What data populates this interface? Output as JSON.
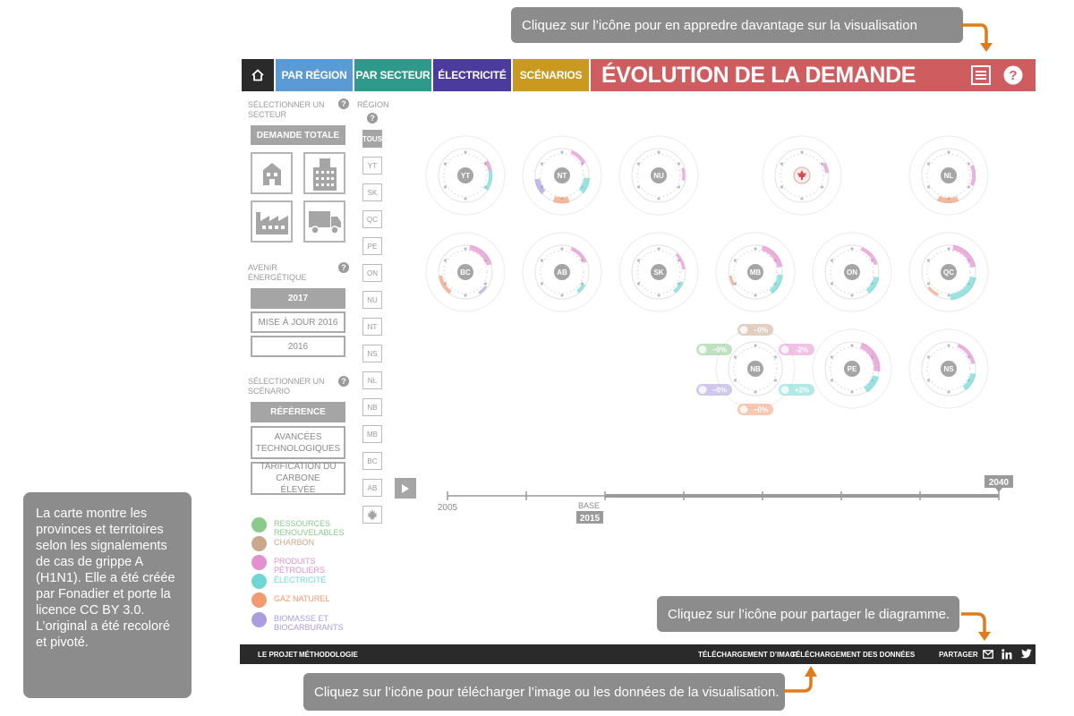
{
  "callouts": {
    "top": "Cliquez sur l’icône pour en appredre davantage sur la visualisation",
    "share": "Cliquez sur l’icône pour partager le diagramme.",
    "download": "Cliquez sur l’icône pour télécharger l’image ou les données de la visualisation.",
    "side": "La carte montre les provinces et territoires selon les signalements de cas de grippe A (H1N1). Elle a été créée par Fonadier et porte la licence CC BY 3.0. L’original a été recoloré et pivoté."
  },
  "header": {
    "home_icon": "home-icon",
    "tabs": [
      "PAR RÉGION",
      "PAR SECTEUR",
      "ÉLECTRICITÉ",
      "SCÉNARIOS"
    ],
    "title": "ÉVOLUTION DE LA DEMANDE",
    "menu_icon": "list-icon",
    "help_icon": "help-icon"
  },
  "sector_panel": {
    "label": "SÉLECTIONNER UN SECTEUR",
    "total_button": "DEMANDE TOTALE",
    "icons": [
      "house-icon",
      "building-icon",
      "factory-icon",
      "truck-icon"
    ]
  },
  "region_panel": {
    "label": "RÉGION",
    "regions": [
      "TOUS",
      "YT",
      "SK",
      "QC",
      "PE",
      "ON",
      "NU",
      "NT",
      "NS",
      "NL",
      "NB",
      "MB",
      "BC",
      "AB"
    ],
    "flag_icon": "canada-flag-icon"
  },
  "avenir_panel": {
    "label": "AVENIR ÉNERGÉTIQUE",
    "options": [
      "2017",
      "MISE À JOUR 2016",
      "2016"
    ]
  },
  "scenario_panel": {
    "label": "SÉLECTIONNER UN SCÉNARIO",
    "options": [
      "RÉFÉRENCE",
      "AVANCÉES TECHNOLOGIQUES",
      "TARIFICATION DU CARBONE ÉLEVÉE"
    ]
  },
  "legend": [
    {
      "label": "RESSOURCES RENOUVELABLES",
      "color": "#8bc98d"
    },
    {
      "label": "CHARBON",
      "color": "#c9a88c"
    },
    {
      "label": "PRODUITS PÉTROLIERS",
      "color": "#e48fd0"
    },
    {
      "label": "ÉLECTRICITÉ",
      "color": "#6fd7d3"
    },
    {
      "label": "GAZ NATUREL",
      "color": "#f19b73"
    },
    {
      "label": "BIOMASSE ET BIOCARBURANTS",
      "color": "#a99ddf"
    }
  ],
  "regions_viz": {
    "row1": [
      "YT",
      "NT",
      "NU",
      "",
      "NL"
    ],
    "row2": [
      "BC",
      "AB",
      "SK",
      "MB",
      "ON",
      "QC"
    ],
    "row3": [
      "NB",
      "PE",
      "NS"
    ],
    "tooltip": {
      "charbon": "~0%",
      "petrole": "-2%",
      "renouv": "~0%",
      "elec": "+2%",
      "bio": "~0%",
      "gaz": "~0%"
    }
  },
  "timeline": {
    "start": "2005",
    "base_label": "BASE",
    "base_year": "2015",
    "end": "2040",
    "play_icon": "play-icon"
  },
  "footer": {
    "links": [
      "LE PROJET",
      "MÉTHODOLOGIE"
    ],
    "downloads": [
      "TÉLÉCHARGEMENT D’IMAGE",
      "TÉLÉCHARGEMENT DES DONNÉES"
    ],
    "share": "PARTAGER",
    "share_icons": [
      "email-icon",
      "linkedin-icon",
      "twitter-icon"
    ]
  }
}
